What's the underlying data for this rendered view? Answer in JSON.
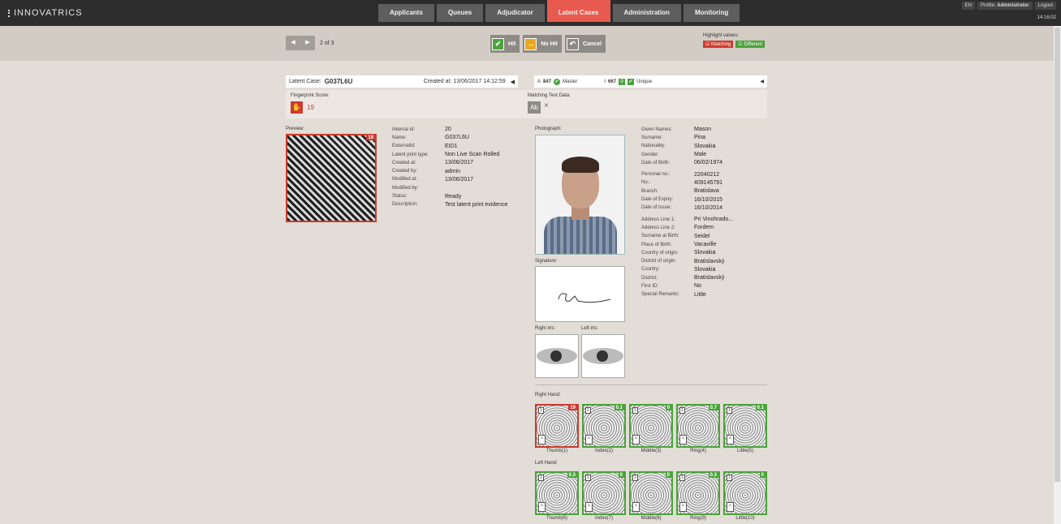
{
  "app": {
    "logo": "INNOVATRICS",
    "nav": [
      "Applicants",
      "Queues",
      "Adjudicator",
      "Latent Cases",
      "Administration",
      "Monitoring"
    ],
    "active_tab": "Latent Cases",
    "topright": {
      "lang": "EN",
      "profile_label": "Profile:",
      "profile_name": "Administrator",
      "logout": "Logout"
    },
    "clock": "14:16:02"
  },
  "toolbar": {
    "prev_icon": "◀",
    "next_icon": "▶",
    "pager_text": "2 of 3",
    "hit": "Hit",
    "nohit": "No Hit",
    "cancel": "Cancel",
    "highlight_title": "Highlight values:",
    "matching": "Matching",
    "different": "Different"
  },
  "latent": {
    "label": "Latent Case:",
    "id": "G037L6U",
    "created": "Created at: 13/06/2017 14:12:59",
    "arrow": "◀"
  },
  "match": {
    "a_label": "A",
    "a_value": "847",
    "master": "Master",
    "i_label": "I",
    "i_value": "667",
    "unique": "Unique",
    "arrow": "◀"
  },
  "score": {
    "label": "Fingerprint Score:",
    "value": "19",
    "matching_text_label": "Matching Text Data:",
    "ab": "Ab",
    "x": "×"
  },
  "preview": {
    "label": "Preview:",
    "badge": "19"
  },
  "case_details": [
    [
      "Internal id:",
      "20"
    ],
    [
      "Name:",
      "G037L6U"
    ],
    [
      "ExternalId:",
      "EID1"
    ],
    [
      "Latent print type:",
      "Non Live Scan Rolled"
    ],
    [
      "Created at:",
      "13/06/2017"
    ],
    [
      "Created by:",
      "admin"
    ],
    [
      "Modified at:",
      "13/06/2017"
    ],
    [
      "Modified by:",
      ""
    ],
    [
      "Status:",
      "Ready"
    ],
    [
      "Description:",
      "Test latent print evidence"
    ]
  ],
  "photo_label": "Photograph:",
  "person_details": [
    [
      "Given Names:",
      "Mason"
    ],
    [
      "Surname:",
      "Pina"
    ],
    [
      "Nationality:",
      "Slovakia"
    ],
    [
      "Gender:",
      "Male"
    ],
    [
      "Date of Birth:",
      "06/02/1974"
    ],
    [
      "",
      ""
    ],
    [
      "Personal no.:",
      "22040212"
    ],
    [
      "No.:",
      "409145791"
    ],
    [
      "Branch:",
      "Bratislava"
    ],
    [
      "Date of Expiry:",
      "16/10/2015"
    ],
    [
      "Date of Issue:",
      "16/10/2014"
    ],
    [
      "",
      ""
    ],
    [
      "Address Line 1:",
      "Pri Vinohrado..."
    ],
    [
      "Address Line 2:",
      "Fordem"
    ],
    [
      "Surname at Birth:",
      "Seidel"
    ],
    [
      "Place of Birth:",
      "Vacaville"
    ],
    [
      "Country of origin:",
      "Slovakia"
    ],
    [
      "District of origin:",
      "Bratislavský"
    ],
    [
      "Country:",
      "Slovakia"
    ],
    [
      "District:",
      "Bratislavský"
    ],
    [
      "First ID:",
      "No"
    ],
    [
      "Special Remarks:",
      "Little"
    ]
  ],
  "signature_label": "Signature:",
  "right_iris": "Right iris:",
  "left_iris": "Left iris:",
  "right_hand": {
    "label": "Right Hand:",
    "fingers": [
      {
        "name": "Thumb(1)",
        "score": "19",
        "color": "red"
      },
      {
        "name": "Index(2)",
        "score": "0.1",
        "color": "green"
      },
      {
        "name": "Middle(3)",
        "score": "0",
        "color": "green"
      },
      {
        "name": "Ring(4)",
        "score": "0.7",
        "color": "green"
      },
      {
        "name": "Little(5)",
        "score": "0.1",
        "color": "green"
      }
    ]
  },
  "left_hand": {
    "label": "Left Hand:",
    "fingers": [
      {
        "name": "Thumb(6)",
        "score": "0.3",
        "color": "green"
      },
      {
        "name": "Index(7)",
        "score": "0",
        "color": "green"
      },
      {
        "name": "Middle(8)",
        "score": "0",
        "color": "green"
      },
      {
        "name": "Ring(9)",
        "score": "0.3",
        "color": "green"
      },
      {
        "name": "Little(10)",
        "score": "0",
        "color": "green"
      }
    ]
  },
  "finger_marks": {
    "top": "1",
    "bottom": "A"
  }
}
